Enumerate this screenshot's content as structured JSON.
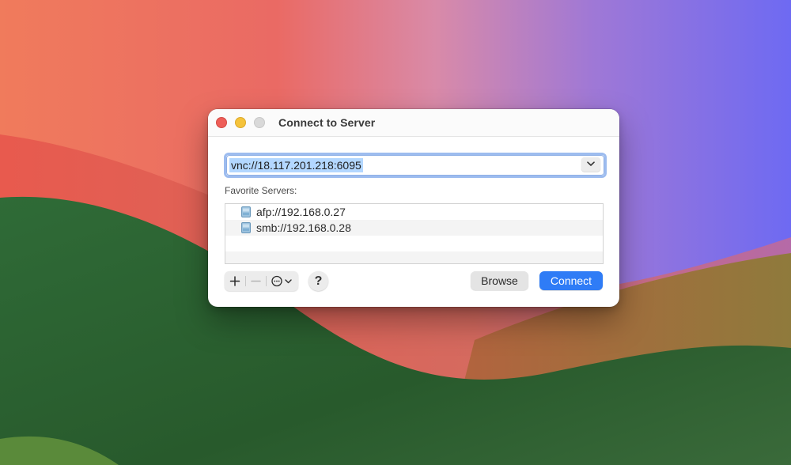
{
  "window": {
    "title": "Connect to Server"
  },
  "address": {
    "value": "vnc://18.117.201.218:6095",
    "dropdown_icon": "chevron-down-icon"
  },
  "favorites": {
    "label": "Favorite Servers:",
    "items": [
      {
        "label": "afp://192.168.0.27",
        "icon": "server-icon"
      },
      {
        "label": "smb://192.168.0.28",
        "icon": "server-icon"
      }
    ]
  },
  "toolbar": {
    "add_icon": "plus-icon",
    "remove_icon": "minus-icon",
    "more_icon": "ellipsis-circle-icon",
    "help_label": "?",
    "browse_label": "Browse",
    "connect_label": "Connect"
  },
  "colors": {
    "accent": "#2f7cf6",
    "selection": "#b3d7ff",
    "close": "#ee5e58",
    "minimize": "#f5c33b",
    "zoom_disabled": "#d9d9d9"
  }
}
